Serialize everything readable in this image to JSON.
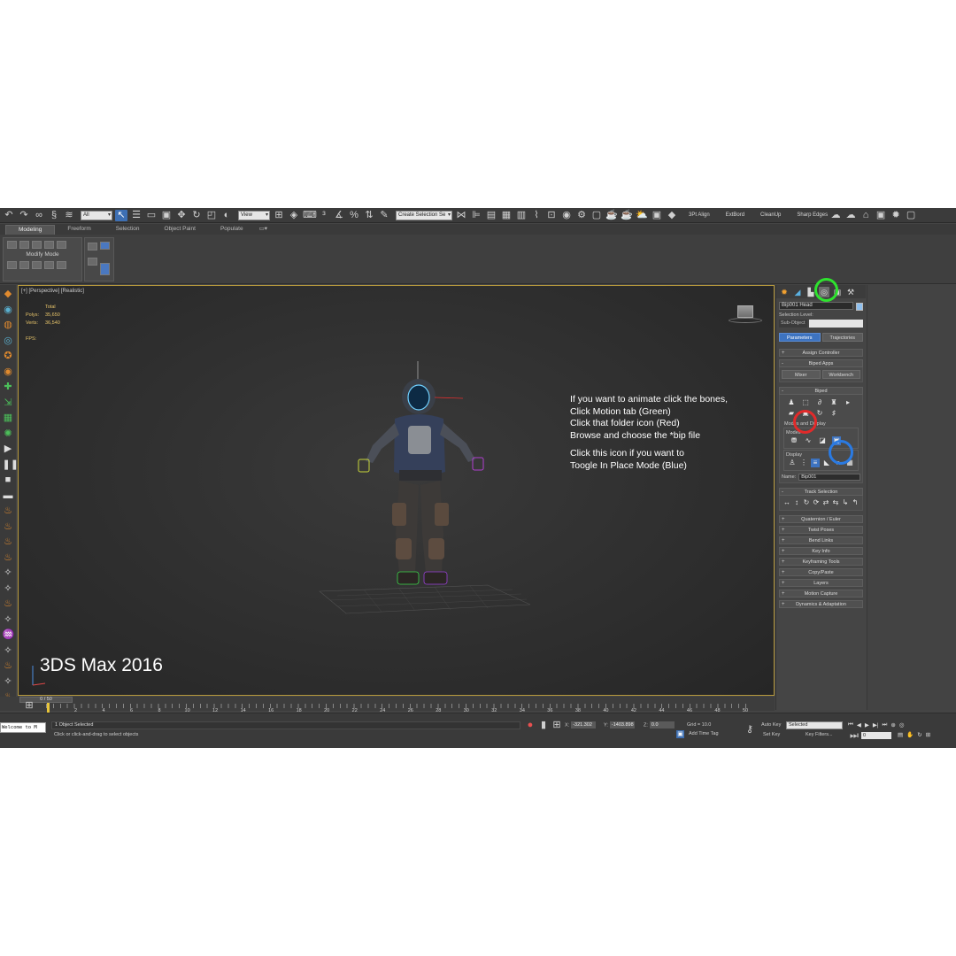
{
  "toolbar": {
    "selection_filter": "All",
    "ref_coord": "View",
    "named_selection": "Create Selection Se",
    "extra_labels": [
      "3Pt Align",
      "ExtBord",
      "CleanUp",
      "Sharp Edges"
    ]
  },
  "ribbon": {
    "tabs": [
      "Modeling",
      "Freeform",
      "Selection",
      "Object Paint",
      "Populate"
    ],
    "panel_label": "Modify Mode"
  },
  "viewport": {
    "label": "[+] [Perspective] [Realistic]",
    "stats": {
      "total_label": "Total",
      "polys_label": "Polys:",
      "polys_value": "35,650",
      "verts_label": "Verts:",
      "verts_value": "36,540",
      "fps_label": "FPS:"
    },
    "instructions": {
      "line1": "If you want to animate click the bones,",
      "line2": "Click Motion tab (Green)",
      "line3": "Click that folder icon (Red)",
      "line4": "Browse and choose the *bip file",
      "line5": "Click this icon if you want to",
      "line6": "Toogle In Place Mode (Blue)"
    },
    "watermark": "3DS Max 2016"
  },
  "command_panel": {
    "object_name": "Bip001 Head",
    "selection_level_label": "Selection Level:",
    "sub_object_label": "Sub-Object",
    "parameters_button": "Parameters",
    "trajectories_button": "Trajectories",
    "assign_controller": "Assign Controller",
    "biped_apps": "Biped Apps",
    "mixer_button": "Mixer",
    "workbench_button": "Workbench",
    "biped_rollout": "Biped",
    "modes_display": "Modes and Display",
    "modes_label": "Modes",
    "display_label": "Display",
    "name_label": "Name:",
    "name_value": "Bip001",
    "track_selection": "Track Selection",
    "rollouts": [
      "Quaternion / Euler",
      "Twist Poses",
      "Bend Links",
      "Key Info",
      "Keyframing Tools",
      "Copy/Paste",
      "Layers",
      "Motion Capture",
      "Dynamics & Adaptation"
    ]
  },
  "timeline": {
    "slider": "0 / 50",
    "ticks": [
      "2",
      "4",
      "6",
      "8",
      "10",
      "12",
      "14",
      "16",
      "18",
      "20",
      "22",
      "24",
      "26",
      "28",
      "30",
      "32",
      "34",
      "36",
      "38",
      "40",
      "42",
      "44",
      "46",
      "48",
      "50"
    ]
  },
  "status": {
    "listener": "Welcome to M",
    "objects": "1 Object Selected",
    "prompt": "Click or click-and-drag to select objects",
    "x_label": "X:",
    "x_value": "-321.302",
    "y_label": "Y:",
    "y_value": "-1403.898",
    "z_label": "Z:",
    "z_value": "0.0",
    "grid": "Grid = 10.0",
    "add_time_tag": "Add Time Tag",
    "auto_key": "Auto Key",
    "set_key": "Set Key",
    "selected_dropdown": "Selected",
    "key_filters": "Key Filters...",
    "current_frame": "0"
  }
}
